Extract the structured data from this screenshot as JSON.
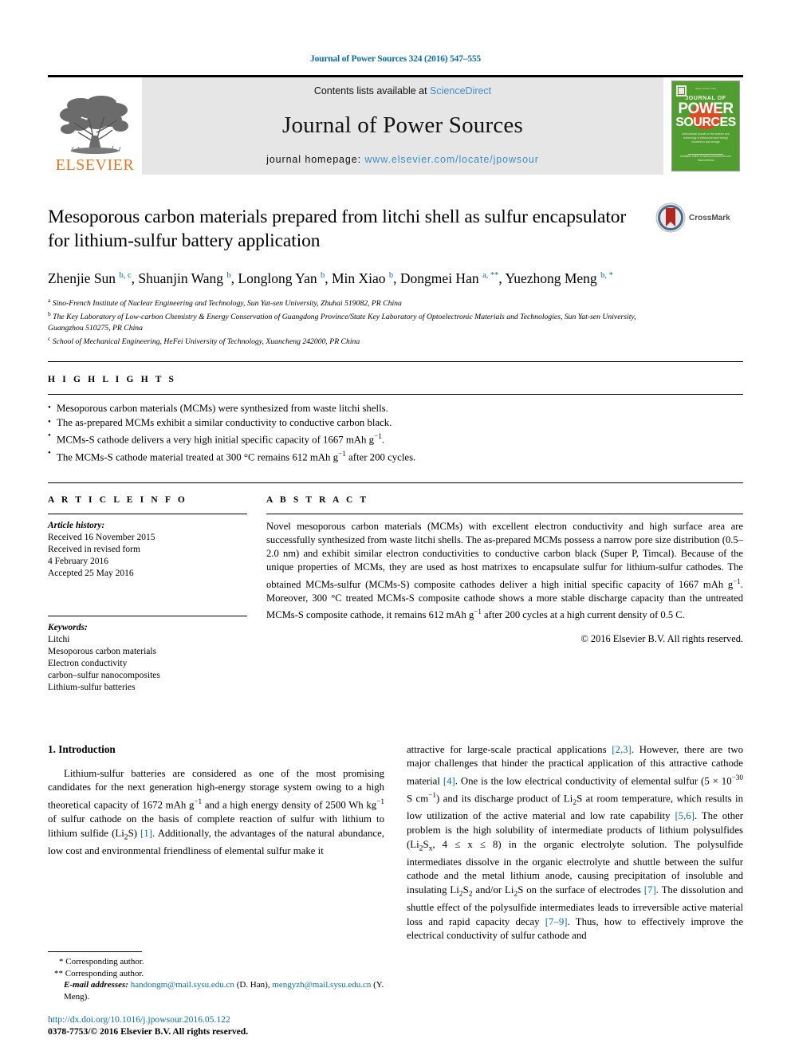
{
  "running_head": "Journal of Power Sources 324 (2016) 547–555",
  "masthead": {
    "publisher_name": "ELSEVIER",
    "contents_prefix": "Contents lists available at ",
    "contents_link": "ScienceDirect",
    "journal_name": "Journal of Power Sources",
    "homepage_prefix": "journal homepage: ",
    "homepage_url": "www.elsevier.com/locate/jpowsour",
    "cover": {
      "top_line": "ISSN 0378-7753",
      "journal_of": "JOURNAL OF",
      "power": "POWER",
      "sources": "SOURCES",
      "subtitle": "International journal on the science and technology of electrochemical energy conversion and storage",
      "footer": "Available online at www.sciencedirect.com  ScienceDirect"
    }
  },
  "article": {
    "title": "Mesoporous carbon materials prepared from litchi shell as sulfur encapsulator for lithium-sulfur battery application",
    "crossmark_label": "CrossMark",
    "authors_html": "Zhenjie Sun <sup>b, c</sup>, Shuanjin Wang <sup>b</sup>, Longlong Yan <sup>b</sup>, Min Xiao <sup>b</sup>, Dongmei Han <sup>a, **</sup>, Yuezhong Meng <sup>b, *</sup>",
    "affiliations": [
      {
        "key": "a",
        "text": "Sino-French Institute of Nuclear Engineering and Technology, Sun Yat-sen University, Zhuhai 519082, PR China"
      },
      {
        "key": "b",
        "text": "The Key Laboratory of Low-carbon Chemistry & Energy Conservation of Guangdong Province/State Key Laboratory of Optoelectronic Materials and Technologies, Sun Yat-sen University, Guangzhou 510275, PR China"
      },
      {
        "key": "c",
        "text": "School of Mechanical Engineering, HeFei University of Technology, Xuancheng 242000, PR China"
      }
    ]
  },
  "highlights": {
    "label": "H I G H L I G H T S",
    "items_html": [
      "Mesoporous carbon materials (MCMs) were synthesized from waste litchi shells.",
      "The as-prepared MCMs exhibit a similar conductivity to conductive carbon black.",
      "MCMs-S cathode delivers a very high initial specific capacity of 1667 mAh g<sup class=\"sm\">−1</sup>.",
      "The MCMs-S cathode material treated at 300 °C remains 612 mAh g<sup class=\"sm\">−1</sup> after 200 cycles."
    ]
  },
  "article_info": {
    "label": "A R T I C L E   I N F O",
    "history_head": "Article history:",
    "history_lines": [
      "Received 16 November 2015",
      "Received in revised form",
      "4 February 2016",
      "Accepted 25 May 2016"
    ],
    "keywords_head": "Keywords:",
    "keywords": [
      "Litchi",
      "Mesoporous carbon materials",
      "Electron conductivity",
      "carbon–sulfur nanocomposites",
      "Lithium-sulfur batteries"
    ]
  },
  "abstract": {
    "label": "A B S T R A C T",
    "text_html": "Novel mesoporous carbon materials (MCMs) with excellent electron conductivity and high surface area are successfully synthesized from waste litchi shells. The as-prepared MCMs possess a narrow pore size distribution (0.5–2.0 nm) and exhibit similar electron conductivities to conductive carbon black (Super P, Timcal). Because of the unique properties of MCMs, they are used as host matrixes to encapsulate sulfur for lithium-sulfur cathodes. The obtained MCMs-sulfur (MCMs-S) composite cathodes deliver a high initial specific capacity of 1667 mAh g<sup class=\"sm\">−1</sup>. Moreover, 300 °C treated MCMs-S composite cathode shows a more stable discharge capacity than the untreated MCMs-S composite cathode, it remains 612 mAh g<sup class=\"sm\">−1</sup> after 200 cycles at a high current density of 0.5 C.",
    "copyright": "© 2016 Elsevier B.V. All rights reserved."
  },
  "body": {
    "section_heading": "1. Introduction",
    "left_column_html": "Lithium-sulfur batteries are considered as one of the most promising candidates for the next generation high-energy storage system owing to a high theoretical capacity of 1672 mAh g<sup class=\"sm\">−1</sup> and a high energy density of 2500 Wh kg<sup class=\"sm\">−1</sup> of sulfur cathode on the basis of complete reaction of sulfur with lithium to lithium sulfide (Li<sub>2</sub>S) <span class=\"ref\">[1]</span>. Additionally, the advantages of the natural abundance, low cost and environmental friendliness of elemental sulfur make it",
    "right_column_html": "attractive for large-scale practical applications <span class=\"ref\">[2,3]</span>. However, there are two major challenges that hinder the practical application of this attractive cathode material <span class=\"ref\">[4]</span>. One is the low electrical conductivity of elemental sulfur (5 × 10<sup class=\"sm\">−30</sup> S cm<sup class=\"sm\">−1</sup>) and its discharge product of Li<sub>2</sub>S at room temperature, which results in low utilization of the active material and low rate capability <span class=\"ref\">[5,6]</span>. The other problem is the high solubility of intermediate products of lithium polysulfides (Li<sub>2</sub>S<sub>x</sub>, 4 ≤ x ≤ 8) in the organic electrolyte solution. The polysulfide intermediates dissolve in the organic electrolyte and shuttle between the sulfur cathode and the metal lithium anode, causing precipitation of insoluble and insulating Li<sub>2</sub>S<sub>2</sub> and/or Li<sub>2</sub>S on the surface of electrodes <span class=\"ref\">[7]</span>. The dissolution and shuttle effect of the polysulfide intermediates leads to irreversible active material loss and rapid capacity decay <span class=\"ref\">[7–9]</span>. Thus, how to effectively improve the electrical conductivity of sulfur cathode and"
  },
  "footnotes": {
    "line1": "* Corresponding author.",
    "line2": "** Corresponding author.",
    "email_label": "E-mail addresses:",
    "email1": "handongm@mail.sysu.edu.cn",
    "email1_who": "(D. Han)",
    "email2": "mengyzh@mail.sysu.edu.cn",
    "email2_who": "(Y. Meng)."
  },
  "doi": {
    "url": "http://dx.doi.org/10.1016/j.jpowsour.2016.05.122",
    "issn_line": "0378-7753/© 2016 Elsevier B.V. All rights reserved."
  },
  "colors": {
    "link_blue": "#0b6ea8",
    "sd_blue": "#3d8fc6",
    "elsevier_orange": "#E87722",
    "cover_green": "#4f9e2f",
    "cover_orange": "#d94d24",
    "masthead_gray": "#e6e6e6"
  }
}
